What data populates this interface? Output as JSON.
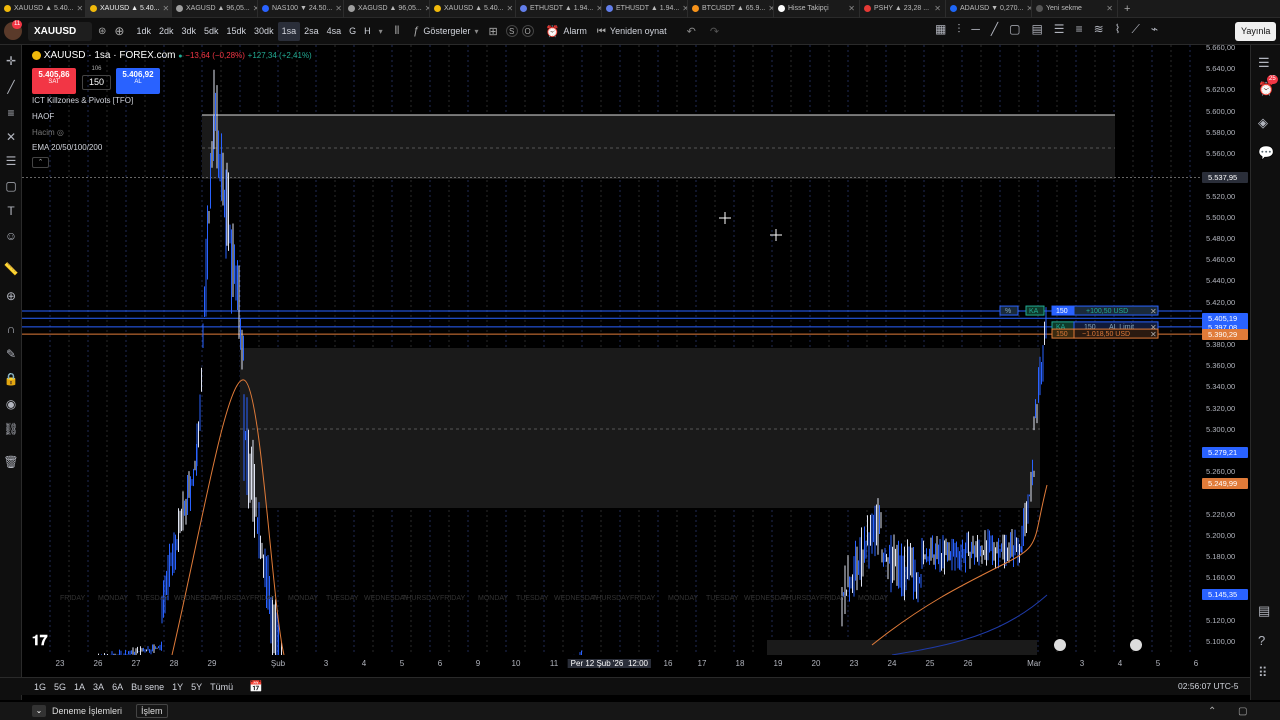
{
  "tabs": [
    {
      "label": "XAUUSD ▲ 5.40...",
      "color": "#f0b90b",
      "active": false
    },
    {
      "label": "XAUUSD ▲ 5.40...",
      "color": "#f0b90b",
      "active": true
    },
    {
      "label": "XAGUSD ▲ 96,05...",
      "color": "#9e9e9e",
      "active": false
    },
    {
      "label": "NAS100 ▼ 24.50...",
      "color": "#2962ff",
      "active": false
    },
    {
      "label": "XAGUSD ▲ 96,05...",
      "color": "#9e9e9e",
      "active": false
    },
    {
      "label": "XAUUSD ▲ 5.40...",
      "color": "#f0b90b",
      "active": false
    },
    {
      "label": "ETHUSDT ▲ 1.94...",
      "color": "#627eea",
      "active": false
    },
    {
      "label": "ETHUSDT ▲ 1.94...",
      "color": "#627eea",
      "active": false
    },
    {
      "label": "BTCUSDT ▲ 65.9...",
      "color": "#f7931a",
      "active": false
    },
    {
      "label": "Hisse Takipçi",
      "color": "#ffffff",
      "active": false
    },
    {
      "label": "PSHY ▲ 23,28 ...",
      "color": "#e53935",
      "active": false
    },
    {
      "label": "ADAUSD ▼ 0,270...",
      "color": "#1e66f5",
      "active": false
    },
    {
      "label": "Yeni sekme",
      "color": "#555555",
      "active": false
    }
  ],
  "toolbar": {
    "symbol": "XAUUSD",
    "intervals": [
      "1dk",
      "2dk",
      "3dk",
      "5dk",
      "15dk",
      "30dk",
      "1sa",
      "2sa",
      "4sa",
      "G",
      "H"
    ],
    "active_interval": "1sa",
    "indicators_label": "Göstergeler",
    "alarm_label": "Alarm",
    "replay_label": "Yeniden oynat",
    "publish_label": "Yayınla",
    "notification_count": "11",
    "right_badge": "25"
  },
  "legend": {
    "title": "XAUUSD · 1sa · FOREX.com",
    "change": "−13,64 (−0,28%)",
    "change2": "+127,34 (+2,41%)",
    "sell_price": "5.405,86",
    "sell_label": "SAT",
    "spread_top": "106",
    "spread": "150",
    "buy_price": "5.406,92",
    "buy_label": "AL"
  },
  "indicators": [
    "ICT Killzones & Pivots [TFO]",
    "HAOF",
    "Hacim",
    "EMA 20/50/100/200"
  ],
  "price_axis": [
    "5.660,00",
    "5.640,00",
    "5.620,00",
    "5.600,00",
    "5.580,00",
    "5.560,00",
    "5.520,00",
    "5.500,00",
    "5.480,00",
    "5.460,00",
    "5.440,00",
    "5.420,00",
    "5.380,00",
    "5.360,00",
    "5.340,00",
    "5.320,00",
    "5.300,00",
    "5.260,00",
    "5.220,00",
    "5.200,00",
    "5.180,00",
    "5.160,00",
    "5.120,00",
    "5.100,00"
  ],
  "price_tags": {
    "crosshair": "5.537,95",
    "last": "5.405,19",
    "limit": "5.397,08",
    "stop": "5.390,29",
    "ema1": "5.279,21",
    "ema2": "5.249,99",
    "ema3": "5.145,35",
    "top": "5.660,00"
  },
  "orders": {
    "pct": "%",
    "ka": "KA",
    "qty": "150",
    "tp_label": "+100,50 USD",
    "limit_label": "AL Limit",
    "sl_label": "−1.018,50 USD"
  },
  "x_axis": [
    "23",
    "26",
    "27",
    "28",
    "29",
    "Şub",
    "3",
    "4",
    "5",
    "6",
    "9",
    "10",
    "11",
    "Per 12 Şub '26",
    "12:00",
    "16",
    "17",
    "18",
    "19",
    "20",
    "23",
    "24",
    "25",
    "26",
    "Mar",
    "3",
    "4",
    "5",
    "6"
  ],
  "session_labels": [
    "FRIDAY",
    "MONDAY",
    "TUESDAY",
    "WEDNESDAY",
    "THURSDAY",
    "FRIDAY",
    "MONDAY",
    "TUESDAY",
    "WEDNESDAY",
    "THURSDAY",
    "FRIDAY",
    "MONDAY",
    "TUESDAY",
    "WEDNESDAY",
    "THURSDAY",
    "FRIDAY",
    "MONDAY",
    "TUESDAY",
    "WEDNESDAY",
    "THURSDAY",
    "FRIDAY",
    "MONDAY"
  ],
  "ranges": [
    "1G",
    "5G",
    "1A",
    "3A",
    "6A",
    "Bu sene",
    "1Y",
    "5Y",
    "Tümü"
  ],
  "clock": "02:56:07 UTC-5",
  "footer": {
    "trading": "Deneme İşlemleri",
    "trade": "İşlem"
  },
  "colors": {
    "up": "#2962ff",
    "ema": "#e07b39",
    "zone": "#1a1a1a",
    "buy": "#2962ff",
    "sell": "#f23645"
  }
}
